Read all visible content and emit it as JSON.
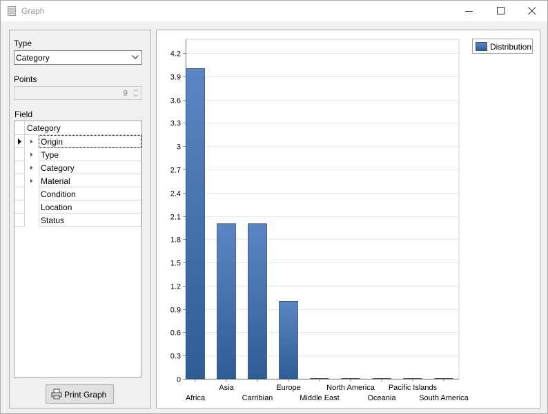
{
  "window": {
    "title": "Graph"
  },
  "left": {
    "type_label": "Type",
    "type_value": "Category",
    "points_label": "Points",
    "points_value": "9",
    "field_label": "Field",
    "grid_header": "Category",
    "fields": [
      {
        "label": "Origin",
        "expandable": true
      },
      {
        "label": "Type",
        "expandable": true
      },
      {
        "label": "Category",
        "expandable": true
      },
      {
        "label": "Material",
        "expandable": true
      },
      {
        "label": "Condition",
        "expandable": false
      },
      {
        "label": "Location",
        "expandable": false
      },
      {
        "label": "Status",
        "expandable": false
      }
    ],
    "print_label": "Print Graph"
  },
  "colors": {
    "bar_top": "#5b86c3",
    "bar_bottom": "#2f5c95",
    "grid": "#e6e6e6"
  },
  "chart_data": {
    "type": "bar",
    "categories": [
      "Africa",
      "Asia",
      "Carribian",
      "Europe",
      "Middle East",
      "North America",
      "Oceania",
      "Pacific Islands",
      "South America"
    ],
    "series": [
      {
        "name": "Distribution",
        "values": [
          4,
          2,
          2,
          1,
          0,
          0,
          0,
          0,
          0
        ]
      }
    ],
    "ylim": [
      0,
      4.2
    ],
    "yticks": [
      "0",
      "0.3",
      "0.6",
      "0.9",
      "1.2",
      "1.5",
      "1.8",
      "2.1",
      "2.4",
      "2.7",
      "3",
      "3.3",
      "3.6",
      "3.9",
      "4.2"
    ],
    "legend": "top-right",
    "grid": true
  }
}
